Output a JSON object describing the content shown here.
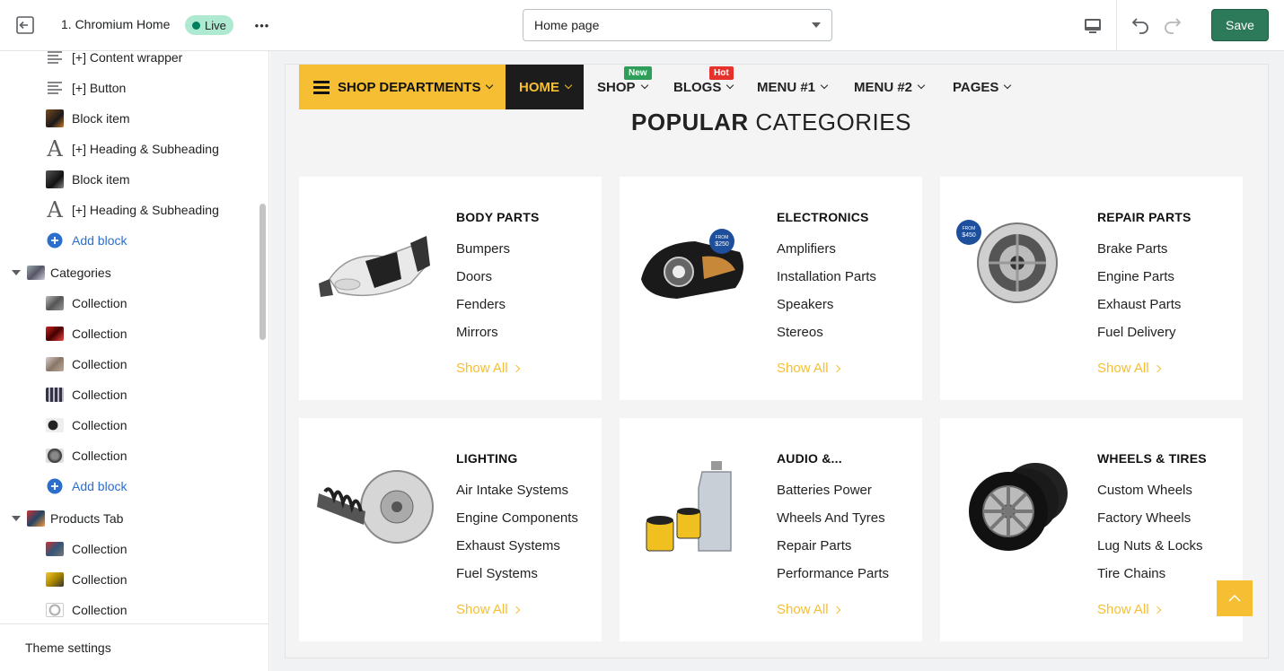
{
  "topbar": {
    "store_name": "1. Chromium Home",
    "live_label": "Live",
    "more_label": "•••",
    "page_select": "Home page",
    "save_label": "Save"
  },
  "sidebar": {
    "items": [
      {
        "label": "[+] Content wrapper",
        "icon": "lines-icon"
      },
      {
        "label": "[+] Button",
        "icon": "lines-icon"
      },
      {
        "label": "Block item",
        "icon": "image-thumb"
      },
      {
        "label": "[+] Heading & Subheading",
        "icon": "heading-icon"
      },
      {
        "label": "Block item",
        "icon": "image-thumb"
      },
      {
        "label": "[+] Heading & Subheading",
        "icon": "heading-icon"
      },
      {
        "label": "Add block",
        "icon": "plus-circle-icon"
      },
      {
        "label": "Categories",
        "icon": "section-thumb"
      },
      {
        "label": "Collection",
        "icon": "image-thumb"
      },
      {
        "label": "Collection",
        "icon": "image-thumb"
      },
      {
        "label": "Collection",
        "icon": "image-thumb"
      },
      {
        "label": "Collection",
        "icon": "image-thumb"
      },
      {
        "label": "Collection",
        "icon": "image-thumb"
      },
      {
        "label": "Collection",
        "icon": "image-thumb"
      },
      {
        "label": "Add block",
        "icon": "plus-circle-icon"
      },
      {
        "label": "Products Tab",
        "icon": "section-thumb"
      },
      {
        "label": "Collection",
        "icon": "image-thumb"
      },
      {
        "label": "Collection",
        "icon": "image-thumb"
      },
      {
        "label": "Collection",
        "icon": "image-thumb"
      }
    ],
    "theme_settings": "Theme settings"
  },
  "preview": {
    "nav": {
      "departments": "SHOP DEPARTMENTS",
      "home": "HOME",
      "shop": "SHOP",
      "shop_badge": "New",
      "blogs": "BLOGS",
      "blogs_badge": "Hot",
      "menu1": "MENU #1",
      "menu2": "MENU #2",
      "pages": "PAGES"
    },
    "title_bold": "POPULAR",
    "title_rest": " CATEGORIES",
    "cards": [
      {
        "title": "BODY PARTS",
        "links": [
          "Bumpers",
          "Doors",
          "Fenders",
          "Mirrors"
        ],
        "show_all": "Show All"
      },
      {
        "title": "ELECTRONICS",
        "links": [
          "Amplifiers",
          "Installation Parts",
          "Speakers",
          "Stereos"
        ],
        "show_all": "Show All"
      },
      {
        "title": "REPAIR PARTS",
        "links": [
          "Brake Parts",
          "Engine Parts",
          "Exhaust Parts",
          "Fuel Delivery"
        ],
        "show_all": "Show All"
      },
      {
        "title": "LIGHTING",
        "links": [
          "Air Intake Systems",
          "Engine Components",
          "Exhaust Systems",
          "Fuel Systems"
        ],
        "show_all": "Show All"
      },
      {
        "title": "AUDIO &...",
        "links": [
          "Batteries Power",
          "Wheels And Tyres",
          "Repair Parts",
          "Performance Parts"
        ],
        "show_all": "Show All"
      },
      {
        "title": "WHEELS & TIRES",
        "links": [
          "Custom Wheels",
          "Factory Wheels",
          "Lug Nuts & Locks",
          "Tire Chains"
        ],
        "show_all": "Show All"
      }
    ],
    "badges": {
      "from_250": "FROM $250",
      "from_450": "FROM $450"
    }
  },
  "colors": {
    "accent": "#f6bf33",
    "save": "#2d7a5a",
    "link_blue": "#2c6ecb",
    "live_bg": "#aee9d1",
    "new_badge": "#2f9e5b",
    "hot_badge": "#e5322d"
  }
}
